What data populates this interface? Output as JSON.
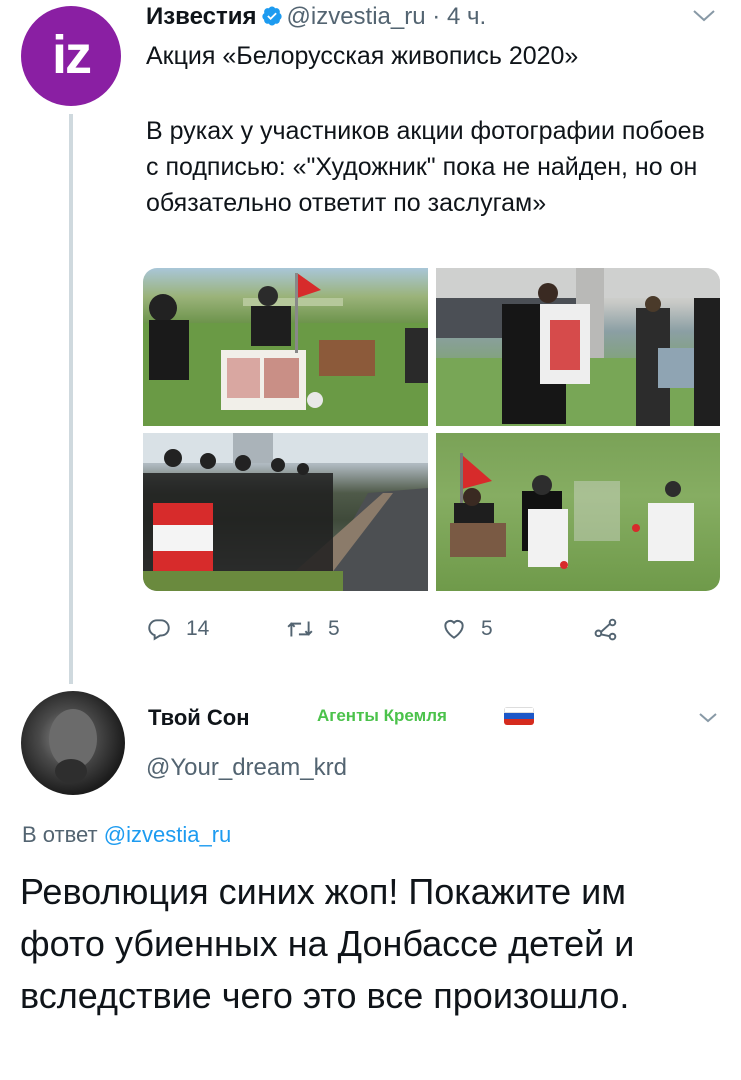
{
  "tweet": {
    "author_name": "Известия",
    "author_handle": "@izvestia_ru",
    "separator": "·",
    "time": "4 ч.",
    "avatar_text": "iz",
    "title": "Акция «Белорусская живопись 2020»",
    "body": "В руках у участников акции фотографии побоев с подписью: «\"Художник\" пока не найден, но он обязательно ответит по заслугам»",
    "actions": {
      "replies": "14",
      "retweets": "5",
      "likes": "5"
    },
    "icons": [
      "verified-badge-icon",
      "chevron-down-icon",
      "reply-icon",
      "retweet-icon",
      "like-icon",
      "share-icon"
    ]
  },
  "reply": {
    "author_name": "Твой Сон",
    "badge": "Агенты Кремля",
    "author_handle": "@Your_dream_krd",
    "reply_prefix": "В ответ",
    "reply_to": "@izvestia_ru",
    "text": "Революция синих жоп! Покажите им фото убиенных на Донбассе детей и вследствие чего это все произошло."
  },
  "colors": {
    "avatar_brand": "#8a1fa3",
    "verified": "#1d9bf0",
    "link": "#1d9bf0",
    "muted": "#536471",
    "badge_green": "#4bc24b",
    "thread_line": "#cfd9de"
  }
}
